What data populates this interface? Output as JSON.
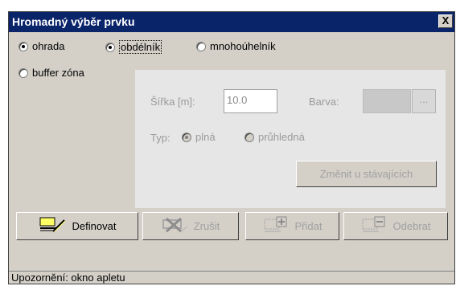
{
  "window": {
    "title": "Hromadný výběr prvku",
    "close_label": "X"
  },
  "radios": {
    "ohrada": {
      "label": "ohrada",
      "checked": true
    },
    "obdelnik": {
      "label": "obdélník",
      "checked": true
    },
    "mnohouhelnik": {
      "label": "mnohoúhelník",
      "checked": false
    },
    "buffer": {
      "label": "buffer zóna",
      "checked": false
    }
  },
  "panel": {
    "width_label": "Šířka [m]:",
    "width_value": "10.0",
    "color_label": "Barva:",
    "color_button": "...",
    "type_label": "Typ:",
    "type_options": [
      {
        "label": "plná",
        "checked": true
      },
      {
        "label": "průhledná",
        "checked": false
      }
    ],
    "change_button": "Změnit u stávajících"
  },
  "buttons": {
    "define": "Definovat",
    "cancel": "Zrušit",
    "add": "Přidat",
    "remove": "Odebrat"
  },
  "status": "Upozornění: okno apletu"
}
